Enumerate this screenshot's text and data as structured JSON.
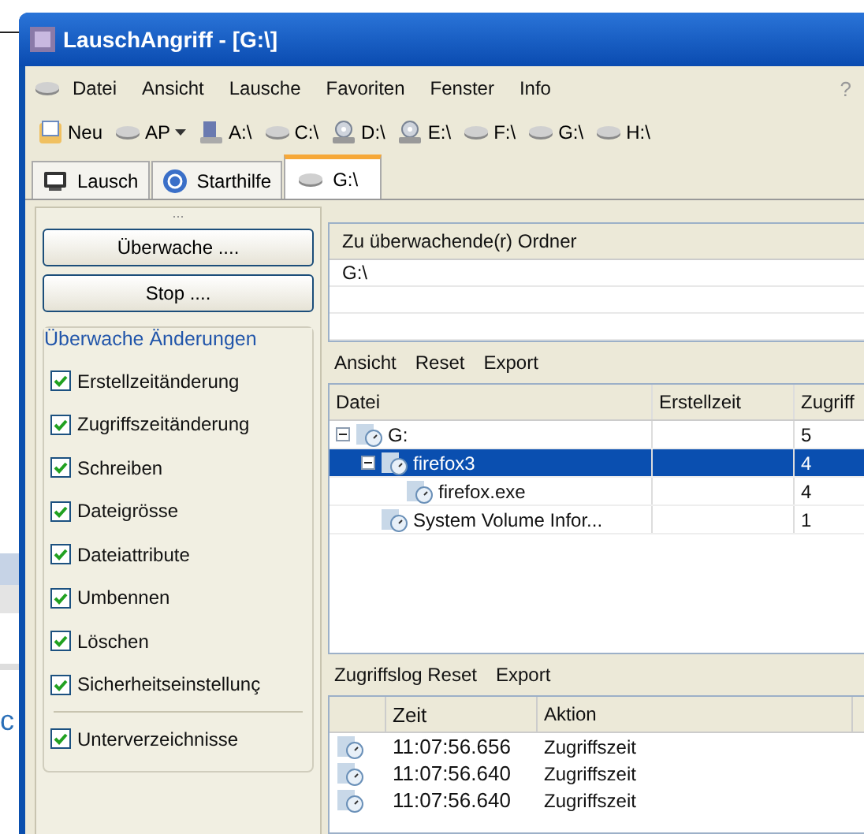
{
  "background_window": {
    "text": "c"
  },
  "window": {
    "title": "LauschAngriff - [G:\\]"
  },
  "menu": [
    "Datei",
    "Ansicht",
    "Lausche",
    "Favoriten",
    "Fenster",
    "Info"
  ],
  "menu_right": [
    "?"
  ],
  "toolbar": [
    {
      "label": "Neu",
      "kind": "new"
    },
    {
      "label": "AP",
      "kind": "dropdown"
    },
    {
      "label": "A:\\",
      "kind": "floppy"
    },
    {
      "label": "C:\\",
      "kind": "drive"
    },
    {
      "label": "D:\\",
      "kind": "cd"
    },
    {
      "label": "E:\\",
      "kind": "cd"
    },
    {
      "label": "F:\\",
      "kind": "drive"
    },
    {
      "label": "G:\\",
      "kind": "drive"
    },
    {
      "label": "H:\\",
      "kind": "drive"
    }
  ],
  "tabs": [
    {
      "label": "Lausch",
      "kind": "monitor",
      "selected": false
    },
    {
      "label": "Starthilfe",
      "kind": "help",
      "selected": false
    },
    {
      "label": "G:\\",
      "kind": "drive",
      "selected": true
    }
  ],
  "sidebar": {
    "grip": "...",
    "buttons": [
      "Überwache ....",
      "Stop ...."
    ],
    "group_title": "Überwache Änderungen",
    "options": [
      {
        "label": "Erstellzeitänderung",
        "checked": true
      },
      {
        "label": "Zugriffszeitänderung",
        "checked": true
      },
      {
        "label": "Schreiben",
        "checked": true
      },
      {
        "label": "Dateigrösse",
        "checked": true
      },
      {
        "label": "Dateiattribute",
        "checked": true
      },
      {
        "label": "Umbennen",
        "checked": true
      },
      {
        "label": "Löschen",
        "checked": true
      },
      {
        "label": "Sicherheitseinstellunç",
        "checked": true
      }
    ],
    "extra_option": {
      "label": "Unterverzeichnisse",
      "checked": true
    }
  },
  "folders": {
    "header": "Zu überwachende(r) Ordner",
    "rows": [
      "G:\\"
    ]
  },
  "tree_toolbar": [
    "Ansicht",
    "Reset",
    "Export"
  ],
  "tree": {
    "columns": [
      "Datei",
      "Erstellzeit",
      "Zugriff"
    ],
    "rows": [
      {
        "name": "G:",
        "access": "5",
        "expanded": true,
        "selected": false,
        "children": [
          {
            "name": "firefox3",
            "access": "4",
            "expanded": true,
            "selected": true,
            "children": [
              {
                "name": "firefox.exe",
                "access": "4",
                "selected": false
              }
            ]
          },
          {
            "name": "System Volume Infor...",
            "access": "1",
            "selected": false
          }
        ]
      }
    ]
  },
  "log_toolbar": [
    "Zugriffslog Reset",
    "Export"
  ],
  "log": {
    "columns": [
      "Zeit",
      "Aktion"
    ],
    "rows": [
      {
        "time": "11:07:56.656",
        "action": "Zugriffszeit"
      },
      {
        "time": "11:07:56.640",
        "action": "Zugriffszeit"
      },
      {
        "time": "11:07:56.640",
        "action": "Zugriffszeit"
      }
    ]
  }
}
